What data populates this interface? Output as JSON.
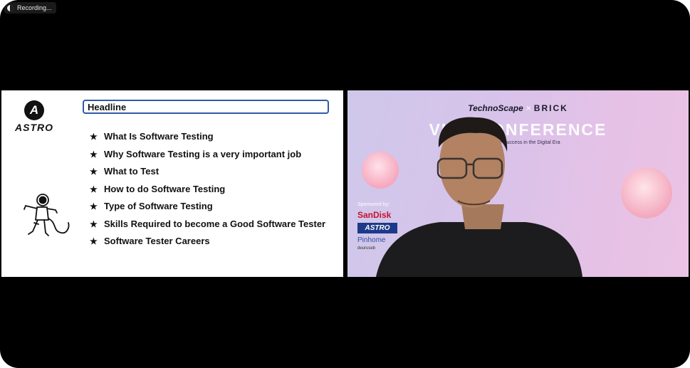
{
  "recording": {
    "label": "Recording..."
  },
  "slide": {
    "logo_text": "ASTRO",
    "headline": "Headline",
    "bullets": [
      "What Is Software Testing",
      "Why Software Testing is a very important job",
      "What to Test",
      "How to do Software Testing",
      "Type of Software Testing",
      "Skills Required to become a Good Software Tester",
      "Software Tester Careers"
    ],
    "bullet_icon": "star-icon"
  },
  "video": {
    "brand_left": "TechnoScape",
    "brand_sep": "×",
    "brand_right": "BRICK",
    "title": "VIRT    CONFERENCE",
    "subtitle": "A                     o Achieve Success in the Digital Era",
    "sponsors_label": "Sponsored by:",
    "sponsors": [
      "SanDisk",
      "ASTRO",
      "Pinhome",
      "deuruseb"
    ]
  },
  "colors": {
    "headline_border": "#2f5aa8",
    "video_bg": "#d7c3ea",
    "frame": "#000000"
  }
}
